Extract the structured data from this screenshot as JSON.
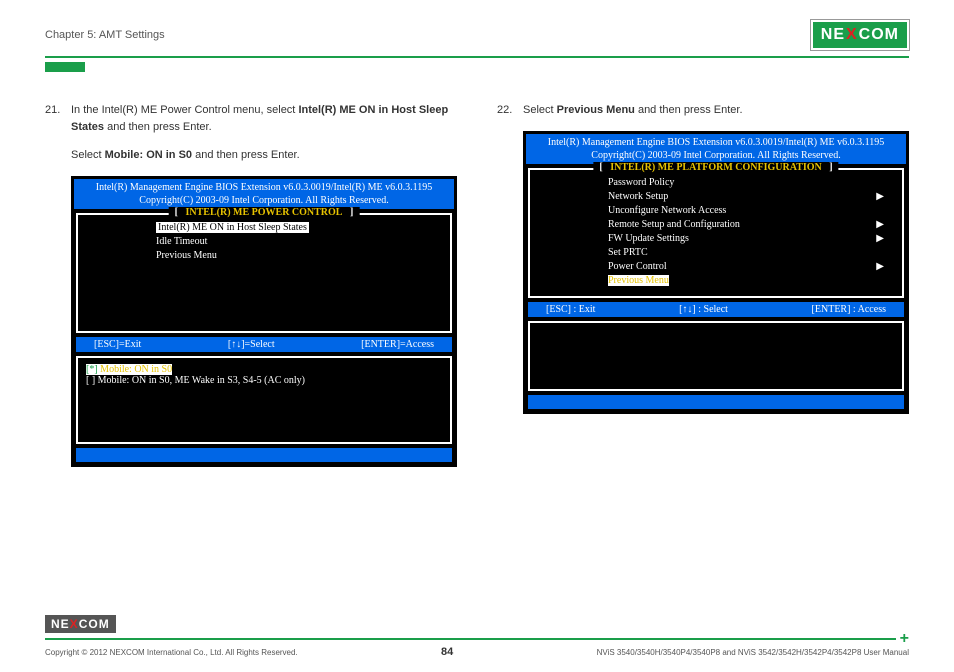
{
  "header": {
    "chapter": "Chapter 5: AMT Settings",
    "logo_text_1": "NE",
    "logo_text_x": "X",
    "logo_text_2": "COM"
  },
  "left": {
    "step_num": "21.",
    "step_text_1": "In the Intel(R) ME Power Control menu, select ",
    "step_bold_1": "Intel(R) ME ON in Host Sleep States",
    "step_text_2": " and then press Enter.",
    "step_text_3": "Select ",
    "step_bold_2": "Mobile: ON in S0",
    "step_text_4": " and then press Enter.",
    "bios": {
      "banner_1": "Intel(R) Management Engine BIOS Extension v6.0.3.0019/Intel(R) ME v6.0.3.1195",
      "banner_2": "Copyright(C) 2003-09 Intel Corporation. All Rights Reserved.",
      "section_title": "INTEL(R) ME POWER CONTROL",
      "items": {
        "i1": "Intel(R) ME ON in Host Sleep States",
        "i2": "Idle Timeout",
        "i3": "Previous Menu"
      },
      "keys": {
        "k1": "[ESC]=Exit",
        "k2": "[↑↓]=Select",
        "k3": "[ENTER]=Access"
      },
      "opt1_prefix": "[*] ",
      "opt1": "Mobile: ON in S0",
      "opt2": "[  ] Mobile: ON in S0, ME Wake in S3, S4-5 (AC only)"
    }
  },
  "right": {
    "step_num": "22.",
    "step_text_1": "Select ",
    "step_bold_1": "Previous Menu",
    "step_text_2": " and then press Enter.",
    "bios": {
      "banner_1": "Intel(R) Management Engine BIOS Extension v6.0.3.0019/Intel(R) ME v6.0.3.1195",
      "banner_2": "Copyright(C) 2003-09 Intel Corporation. All Rights Reserved.",
      "section_title": "INTEL(R) ME PLATFORM CONFIGURATION",
      "items": {
        "i1": "Password Policy",
        "i2": "Network Setup",
        "i3": "Unconfigure Network Access",
        "i4": "Remote Setup and Configuration",
        "i5": "FW Update Settings",
        "i6": "Set PRTC",
        "i7": "Power Control",
        "i8": "Previous Menu"
      },
      "keys": {
        "k1": "[ESC] : Exit",
        "k2": "[↑↓] : Select",
        "k3": "[ENTER] : Access"
      }
    }
  },
  "footer": {
    "copyright": "Copyright © 2012 NEXCOM International Co., Ltd. All Rights Reserved.",
    "page_num": "84",
    "manual": "NViS 3540/3540H/3540P4/3540P8 and NViS 3542/3542H/3542P4/3542P8 User Manual"
  }
}
